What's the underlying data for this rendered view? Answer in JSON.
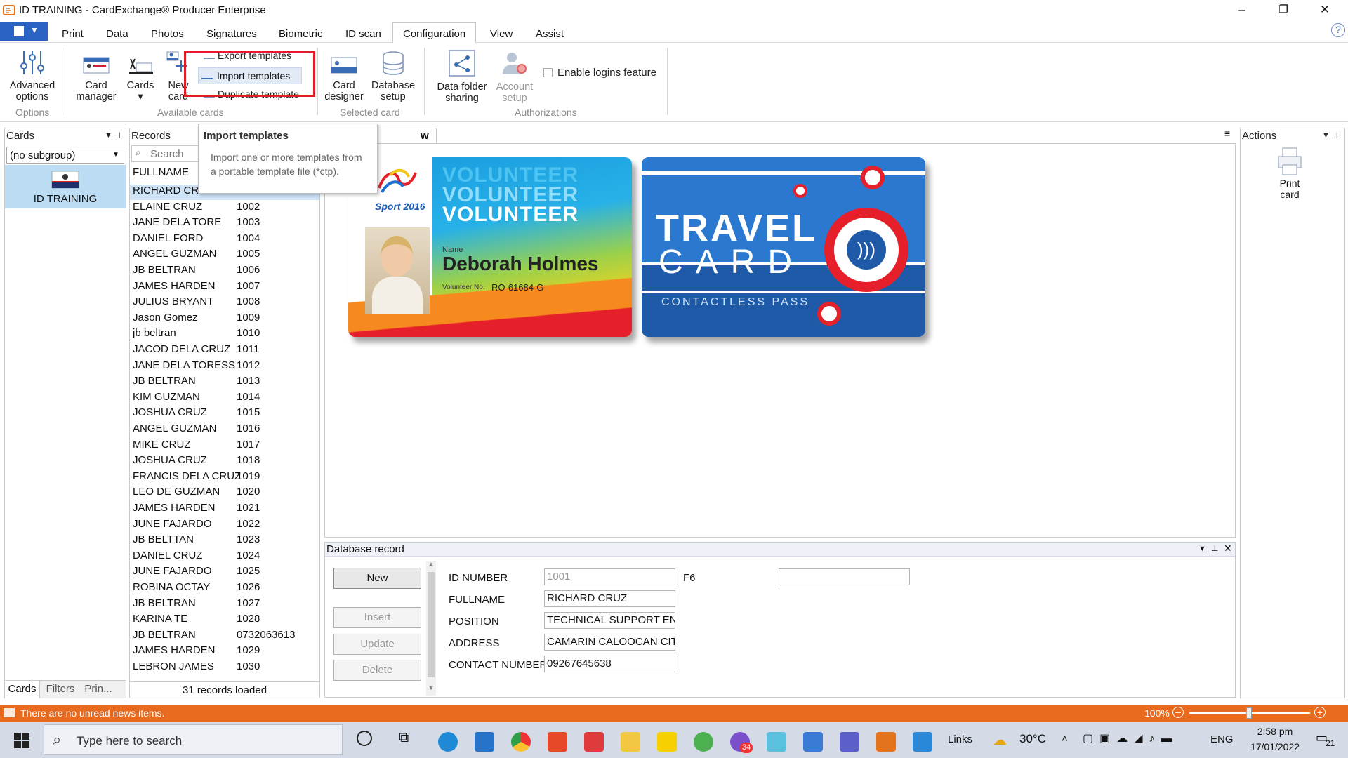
{
  "window": {
    "title": "ID TRAINING - CardExchange® Producer Enterprise",
    "minimize": "–",
    "restore": "❐",
    "close": "✕"
  },
  "menu": {
    "tabs": [
      {
        "label": "Print"
      },
      {
        "label": "Data"
      },
      {
        "label": "Photos"
      },
      {
        "label": "Signatures"
      },
      {
        "label": "Biometric"
      },
      {
        "label": "ID scan"
      },
      {
        "label": "Configuration"
      },
      {
        "label": "View"
      },
      {
        "label": "Assist"
      }
    ],
    "help": "?"
  },
  "ribbon": {
    "advanced_options": [
      "Advanced",
      "options"
    ],
    "card_manager": [
      "Card",
      "manager"
    ],
    "cards": [
      "Cards",
      "▾"
    ],
    "new_card": [
      "New",
      "card"
    ],
    "export_templates": "Export templates",
    "import_templates": "Import templates",
    "duplicate_template": "Duplicate template",
    "card_designer": [
      "Card",
      "designer"
    ],
    "database_setup": [
      "Database",
      "setup"
    ],
    "data_folder_sharing": [
      "Data folder",
      "sharing"
    ],
    "account_setup": [
      "Account",
      "setup"
    ],
    "enable_logins": "Enable logins feature",
    "groups": {
      "options": "Options",
      "available_cards": "Available cards",
      "selected_card": "Selected card",
      "authorizations": "Authorizations"
    }
  },
  "tooltip": {
    "title": "Import templates",
    "description": "Import one or more templates from a portable template file (*ctp)."
  },
  "cards_panel": {
    "title": "Cards",
    "subgroup": "(no subgroup)",
    "card_name": "ID TRAINING",
    "bottom_tabs": [
      "Cards",
      "Filters",
      "Prin..."
    ]
  },
  "records_panel": {
    "title": "Records",
    "search_placeholder": "Search",
    "column": "FULLNAME",
    "footer": "31 records loaded",
    "rows": [
      {
        "name": "RICHARD CRUZ",
        "id": "1001"
      },
      {
        "name": "ELAINE CRUZ",
        "id": "1002"
      },
      {
        "name": "JANE DELA TORE",
        "id": "1003"
      },
      {
        "name": "DANIEL FORD",
        "id": "1004"
      },
      {
        "name": "ANGEL GUZMAN",
        "id": "1005"
      },
      {
        "name": "JB BELTRAN",
        "id": "1006"
      },
      {
        "name": "JAMES HARDEN",
        "id": "1007"
      },
      {
        "name": "JULIUS BRYANT",
        "id": "1008"
      },
      {
        "name": "Jason Gomez",
        "id": "1009"
      },
      {
        "name": "jb beltran",
        "id": "1010"
      },
      {
        "name": "JACOD DELA CRUZ",
        "id": "1011"
      },
      {
        "name": "JANE DELA TORESS",
        "id": "1012"
      },
      {
        "name": "JB BELTRAN",
        "id": "1013"
      },
      {
        "name": "KIM GUZMAN",
        "id": "1014"
      },
      {
        "name": "JOSHUA CRUZ",
        "id": "1015"
      },
      {
        "name": "ANGEL GUZMAN",
        "id": "1016"
      },
      {
        "name": "MIKE CRUZ",
        "id": "1017"
      },
      {
        "name": "JOSHUA CRUZ",
        "id": "1018"
      },
      {
        "name": "FRANCIS DELA CRUZ",
        "id": "1019"
      },
      {
        "name": "LEO DE GUZMAN",
        "id": "1020"
      },
      {
        "name": "JAMES HARDEN",
        "id": "1021"
      },
      {
        "name": "JUNE FAJARDO",
        "id": "1022"
      },
      {
        "name": "JB BELTTAN",
        "id": "1023"
      },
      {
        "name": "DANIEL CRUZ",
        "id": "1024"
      },
      {
        "name": "JUNE FAJARDO",
        "id": "1025"
      },
      {
        "name": "ROBINA OCTAY",
        "id": "1026"
      },
      {
        "name": "JB BELTRAN",
        "id": "1027"
      },
      {
        "name": "KARINA TE",
        "id": "1028"
      },
      {
        "name": "JB BELTRAN",
        "id": "0732063613"
      },
      {
        "name": "JAMES HARDEN",
        "id": "1029"
      },
      {
        "name": "LEBRON JAMES",
        "id": "1030"
      }
    ]
  },
  "preview": {
    "tab": "w",
    "volunteer_card": {
      "brand": "Sport 2016",
      "heading": "VOLUNTEER",
      "name_label": "Name",
      "name": "Deborah Holmes",
      "number_label": "Volunteer No.",
      "number": "RO-61684-G"
    },
    "travel_card": {
      "line1": "TRAVEL",
      "line2": "CARD",
      "subtitle": "CONTACTLESS PASS"
    }
  },
  "actions_panel": {
    "title": "Actions",
    "print_card": [
      "Print",
      "card"
    ]
  },
  "db_record": {
    "title": "Database record",
    "buttons": {
      "new": "New",
      "insert": "Insert",
      "update": "Update",
      "delete": "Delete"
    },
    "fields": [
      {
        "label": "ID NUMBER",
        "value": "1001"
      },
      {
        "label": "FULLNAME",
        "value": "RICHARD CRUZ"
      },
      {
        "label": "POSITION",
        "value": "TECHNICAL SUPPORT ENGI"
      },
      {
        "label": "ADDRESS",
        "value": "CAMARIN CALOOCAN CITY"
      },
      {
        "label": "CONTACT NUMBER",
        "value": "09267645638"
      }
    ],
    "f6_label": "F6",
    "f6_value": ""
  },
  "status": {
    "news": "There are no unread news items.",
    "zoom": "100%",
    "zoom_fraction": 0.47
  },
  "taskbar": {
    "search_placeholder": "Type here to search",
    "links": "Links",
    "temperature": "30°C",
    "language": "ENG",
    "time": "2:58 pm",
    "date": "17/01/2022",
    "notifications": "21",
    "viber_badge": "34"
  },
  "colors": {
    "accent": "#2b63c4",
    "highlight_red": "#e41b23",
    "news_orange": "#e86a1f",
    "selected_row": "#cfe3f7",
    "card_selected": "#bcdcf4"
  }
}
